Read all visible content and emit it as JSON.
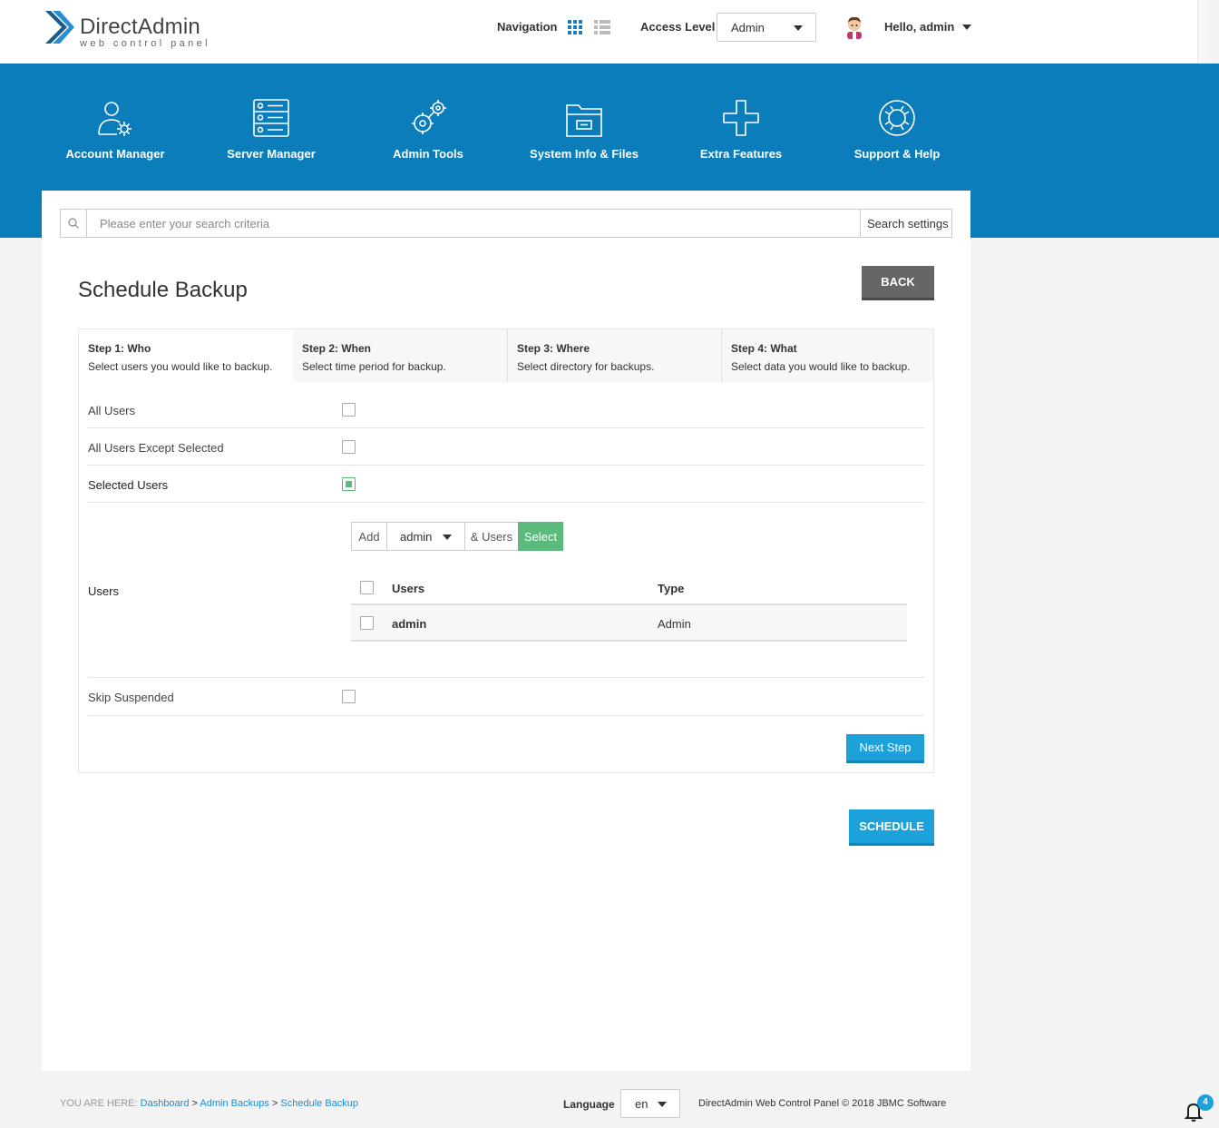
{
  "header": {
    "logo_title": "DirectAdmin",
    "logo_subtitle": "web control panel",
    "navigation_label": "Navigation",
    "access_level_label": "Access Level",
    "access_level_value": "Admin",
    "greeting": "Hello, admin"
  },
  "main_menu": [
    {
      "label": "Account Manager",
      "icon": "account-manager-icon"
    },
    {
      "label": "Server Manager",
      "icon": "server-manager-icon"
    },
    {
      "label": "Admin Tools",
      "icon": "admin-tools-icon"
    },
    {
      "label": "System Info & Files",
      "icon": "system-info-icon"
    },
    {
      "label": "Extra Features",
      "icon": "extra-features-icon"
    },
    {
      "label": "Support & Help",
      "icon": "support-help-icon"
    }
  ],
  "search": {
    "placeholder": "Please enter your search criteria",
    "settings_label": "Search settings"
  },
  "page": {
    "title": "Schedule Backup",
    "back_label": "BACK",
    "schedule_label": "SCHEDULE"
  },
  "wizard": {
    "steps": [
      {
        "title": "Step 1: Who",
        "desc": "Select users you would like to backup."
      },
      {
        "title": "Step 2: When",
        "desc": "Select time period for backup."
      },
      {
        "title": "Step 3: Where",
        "desc": "Select directory for backups."
      },
      {
        "title": "Step 4: What",
        "desc": "Select data you would like to backup."
      }
    ],
    "options": {
      "all_users": "All Users",
      "all_except": "All Users Except Selected",
      "selected_users": "Selected Users",
      "users": "Users",
      "skip_suspended": "Skip Suspended"
    },
    "add_bar": {
      "add": "Add",
      "user_value": "admin",
      "and_users": "& Users",
      "select": "Select"
    },
    "table": {
      "headers": [
        "Users",
        "Type"
      ],
      "rows": [
        {
          "user": "admin",
          "type": "Admin"
        }
      ]
    },
    "next_label": "Next Step"
  },
  "footer": {
    "you_are_here": "YOU ARE HERE:",
    "breadcrumb": [
      "Dashboard",
      "Admin Backups",
      "Schedule Backup"
    ],
    "language_label": "Language",
    "language_value": "en",
    "copyright": "DirectAdmin Web Control Panel © 2018 JBMC Software",
    "notification_count": "4"
  },
  "colors": {
    "brand_blue": "#0a7dba",
    "button_blue": "#1da1db",
    "select_green": "#5cba7d"
  }
}
